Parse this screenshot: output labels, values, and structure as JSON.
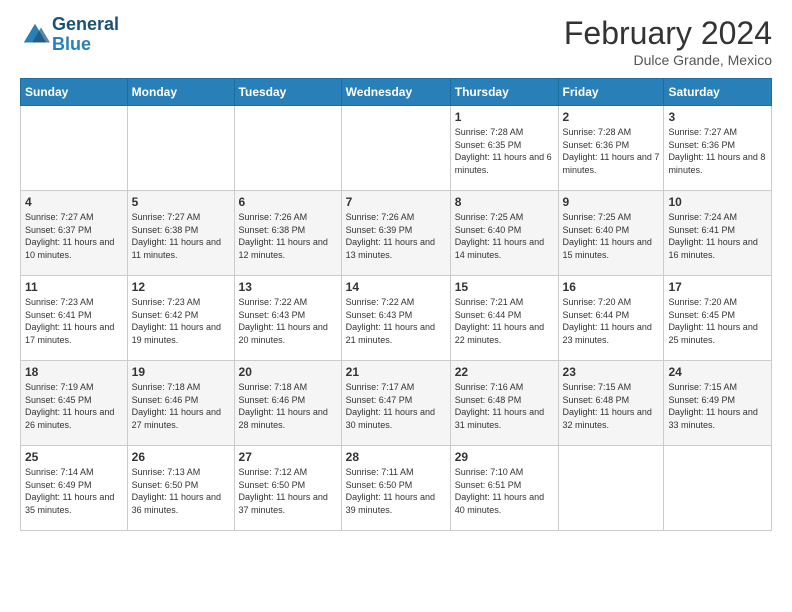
{
  "logo": {
    "line1": "General",
    "line2": "Blue"
  },
  "title": "February 2024",
  "location": "Dulce Grande, Mexico",
  "days_of_week": [
    "Sunday",
    "Monday",
    "Tuesday",
    "Wednesday",
    "Thursday",
    "Friday",
    "Saturday"
  ],
  "weeks": [
    [
      {
        "day": "",
        "info": ""
      },
      {
        "day": "",
        "info": ""
      },
      {
        "day": "",
        "info": ""
      },
      {
        "day": "",
        "info": ""
      },
      {
        "day": "1",
        "info": "Sunrise: 7:28 AM\nSunset: 6:35 PM\nDaylight: 11 hours and 6 minutes."
      },
      {
        "day": "2",
        "info": "Sunrise: 7:28 AM\nSunset: 6:36 PM\nDaylight: 11 hours and 7 minutes."
      },
      {
        "day": "3",
        "info": "Sunrise: 7:27 AM\nSunset: 6:36 PM\nDaylight: 11 hours and 8 minutes."
      }
    ],
    [
      {
        "day": "4",
        "info": "Sunrise: 7:27 AM\nSunset: 6:37 PM\nDaylight: 11 hours and 10 minutes."
      },
      {
        "day": "5",
        "info": "Sunrise: 7:27 AM\nSunset: 6:38 PM\nDaylight: 11 hours and 11 minutes."
      },
      {
        "day": "6",
        "info": "Sunrise: 7:26 AM\nSunset: 6:38 PM\nDaylight: 11 hours and 12 minutes."
      },
      {
        "day": "7",
        "info": "Sunrise: 7:26 AM\nSunset: 6:39 PM\nDaylight: 11 hours and 13 minutes."
      },
      {
        "day": "8",
        "info": "Sunrise: 7:25 AM\nSunset: 6:40 PM\nDaylight: 11 hours and 14 minutes."
      },
      {
        "day": "9",
        "info": "Sunrise: 7:25 AM\nSunset: 6:40 PM\nDaylight: 11 hours and 15 minutes."
      },
      {
        "day": "10",
        "info": "Sunrise: 7:24 AM\nSunset: 6:41 PM\nDaylight: 11 hours and 16 minutes."
      }
    ],
    [
      {
        "day": "11",
        "info": "Sunrise: 7:23 AM\nSunset: 6:41 PM\nDaylight: 11 hours and 17 minutes."
      },
      {
        "day": "12",
        "info": "Sunrise: 7:23 AM\nSunset: 6:42 PM\nDaylight: 11 hours and 19 minutes."
      },
      {
        "day": "13",
        "info": "Sunrise: 7:22 AM\nSunset: 6:43 PM\nDaylight: 11 hours and 20 minutes."
      },
      {
        "day": "14",
        "info": "Sunrise: 7:22 AM\nSunset: 6:43 PM\nDaylight: 11 hours and 21 minutes."
      },
      {
        "day": "15",
        "info": "Sunrise: 7:21 AM\nSunset: 6:44 PM\nDaylight: 11 hours and 22 minutes."
      },
      {
        "day": "16",
        "info": "Sunrise: 7:20 AM\nSunset: 6:44 PM\nDaylight: 11 hours and 23 minutes."
      },
      {
        "day": "17",
        "info": "Sunrise: 7:20 AM\nSunset: 6:45 PM\nDaylight: 11 hours and 25 minutes."
      }
    ],
    [
      {
        "day": "18",
        "info": "Sunrise: 7:19 AM\nSunset: 6:45 PM\nDaylight: 11 hours and 26 minutes."
      },
      {
        "day": "19",
        "info": "Sunrise: 7:18 AM\nSunset: 6:46 PM\nDaylight: 11 hours and 27 minutes."
      },
      {
        "day": "20",
        "info": "Sunrise: 7:18 AM\nSunset: 6:46 PM\nDaylight: 11 hours and 28 minutes."
      },
      {
        "day": "21",
        "info": "Sunrise: 7:17 AM\nSunset: 6:47 PM\nDaylight: 11 hours and 30 minutes."
      },
      {
        "day": "22",
        "info": "Sunrise: 7:16 AM\nSunset: 6:48 PM\nDaylight: 11 hours and 31 minutes."
      },
      {
        "day": "23",
        "info": "Sunrise: 7:15 AM\nSunset: 6:48 PM\nDaylight: 11 hours and 32 minutes."
      },
      {
        "day": "24",
        "info": "Sunrise: 7:15 AM\nSunset: 6:49 PM\nDaylight: 11 hours and 33 minutes."
      }
    ],
    [
      {
        "day": "25",
        "info": "Sunrise: 7:14 AM\nSunset: 6:49 PM\nDaylight: 11 hours and 35 minutes."
      },
      {
        "day": "26",
        "info": "Sunrise: 7:13 AM\nSunset: 6:50 PM\nDaylight: 11 hours and 36 minutes."
      },
      {
        "day": "27",
        "info": "Sunrise: 7:12 AM\nSunset: 6:50 PM\nDaylight: 11 hours and 37 minutes."
      },
      {
        "day": "28",
        "info": "Sunrise: 7:11 AM\nSunset: 6:50 PM\nDaylight: 11 hours and 39 minutes."
      },
      {
        "day": "29",
        "info": "Sunrise: 7:10 AM\nSunset: 6:51 PM\nDaylight: 11 hours and 40 minutes."
      },
      {
        "day": "",
        "info": ""
      },
      {
        "day": "",
        "info": ""
      }
    ]
  ]
}
